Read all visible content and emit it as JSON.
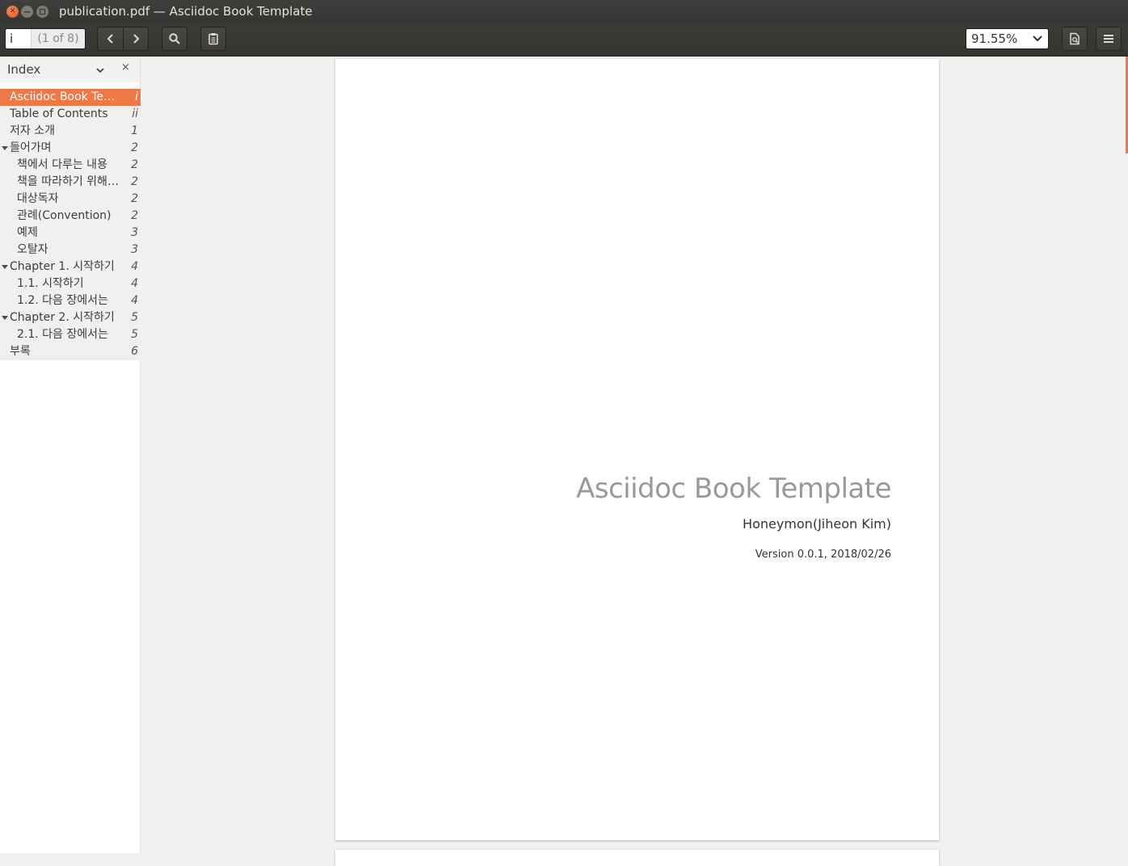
{
  "window": {
    "title": "publication.pdf — Asciidoc Book Template"
  },
  "toolbar": {
    "page_current": "i",
    "page_total": "(1 of 8)",
    "zoom": "91.55%"
  },
  "sidebar": {
    "header": "Index",
    "close": "×",
    "items": [
      {
        "label": "Asciidoc Book Tem···",
        "page": "i",
        "level": 0,
        "selected": true
      },
      {
        "label": "Table of Contents",
        "page": "ii",
        "level": 0
      },
      {
        "label": "저자 소개",
        "page": "1",
        "level": 0
      },
      {
        "label": "들어가며",
        "page": "2",
        "level": 0,
        "expanded": true
      },
      {
        "label": "책에서 다루는 내용",
        "page": "2",
        "level": 1
      },
      {
        "label": "책을 따라하기 위해 ...",
        "page": "2",
        "level": 1
      },
      {
        "label": "대상독자",
        "page": "2",
        "level": 1
      },
      {
        "label": "관례(Convention)",
        "page": "2",
        "level": 1
      },
      {
        "label": "예제",
        "page": "3",
        "level": 1
      },
      {
        "label": "오탈자",
        "page": "3",
        "level": 1
      },
      {
        "label": "Chapter 1. 시작하기",
        "page": "4",
        "level": 0,
        "expanded": true
      },
      {
        "label": "1.1. 시작하기",
        "page": "4",
        "level": 1
      },
      {
        "label": "1.2. 다음 장에서는",
        "page": "4",
        "level": 1
      },
      {
        "label": "Chapter 2. 시작하기",
        "page": "5",
        "level": 0,
        "expanded": true
      },
      {
        "label": "2.1. 다음 장에서는",
        "page": "5",
        "level": 1
      },
      {
        "label": "부록",
        "page": "6",
        "level": 0
      }
    ]
  },
  "document": {
    "title": "Asciidoc Book Template",
    "author": "Honeymon(Jiheon Kim)",
    "version": "Version 0.0.1, 2018/02/26"
  },
  "colors": {
    "accent": "#f07746",
    "titlebar": "#3c3b37"
  }
}
